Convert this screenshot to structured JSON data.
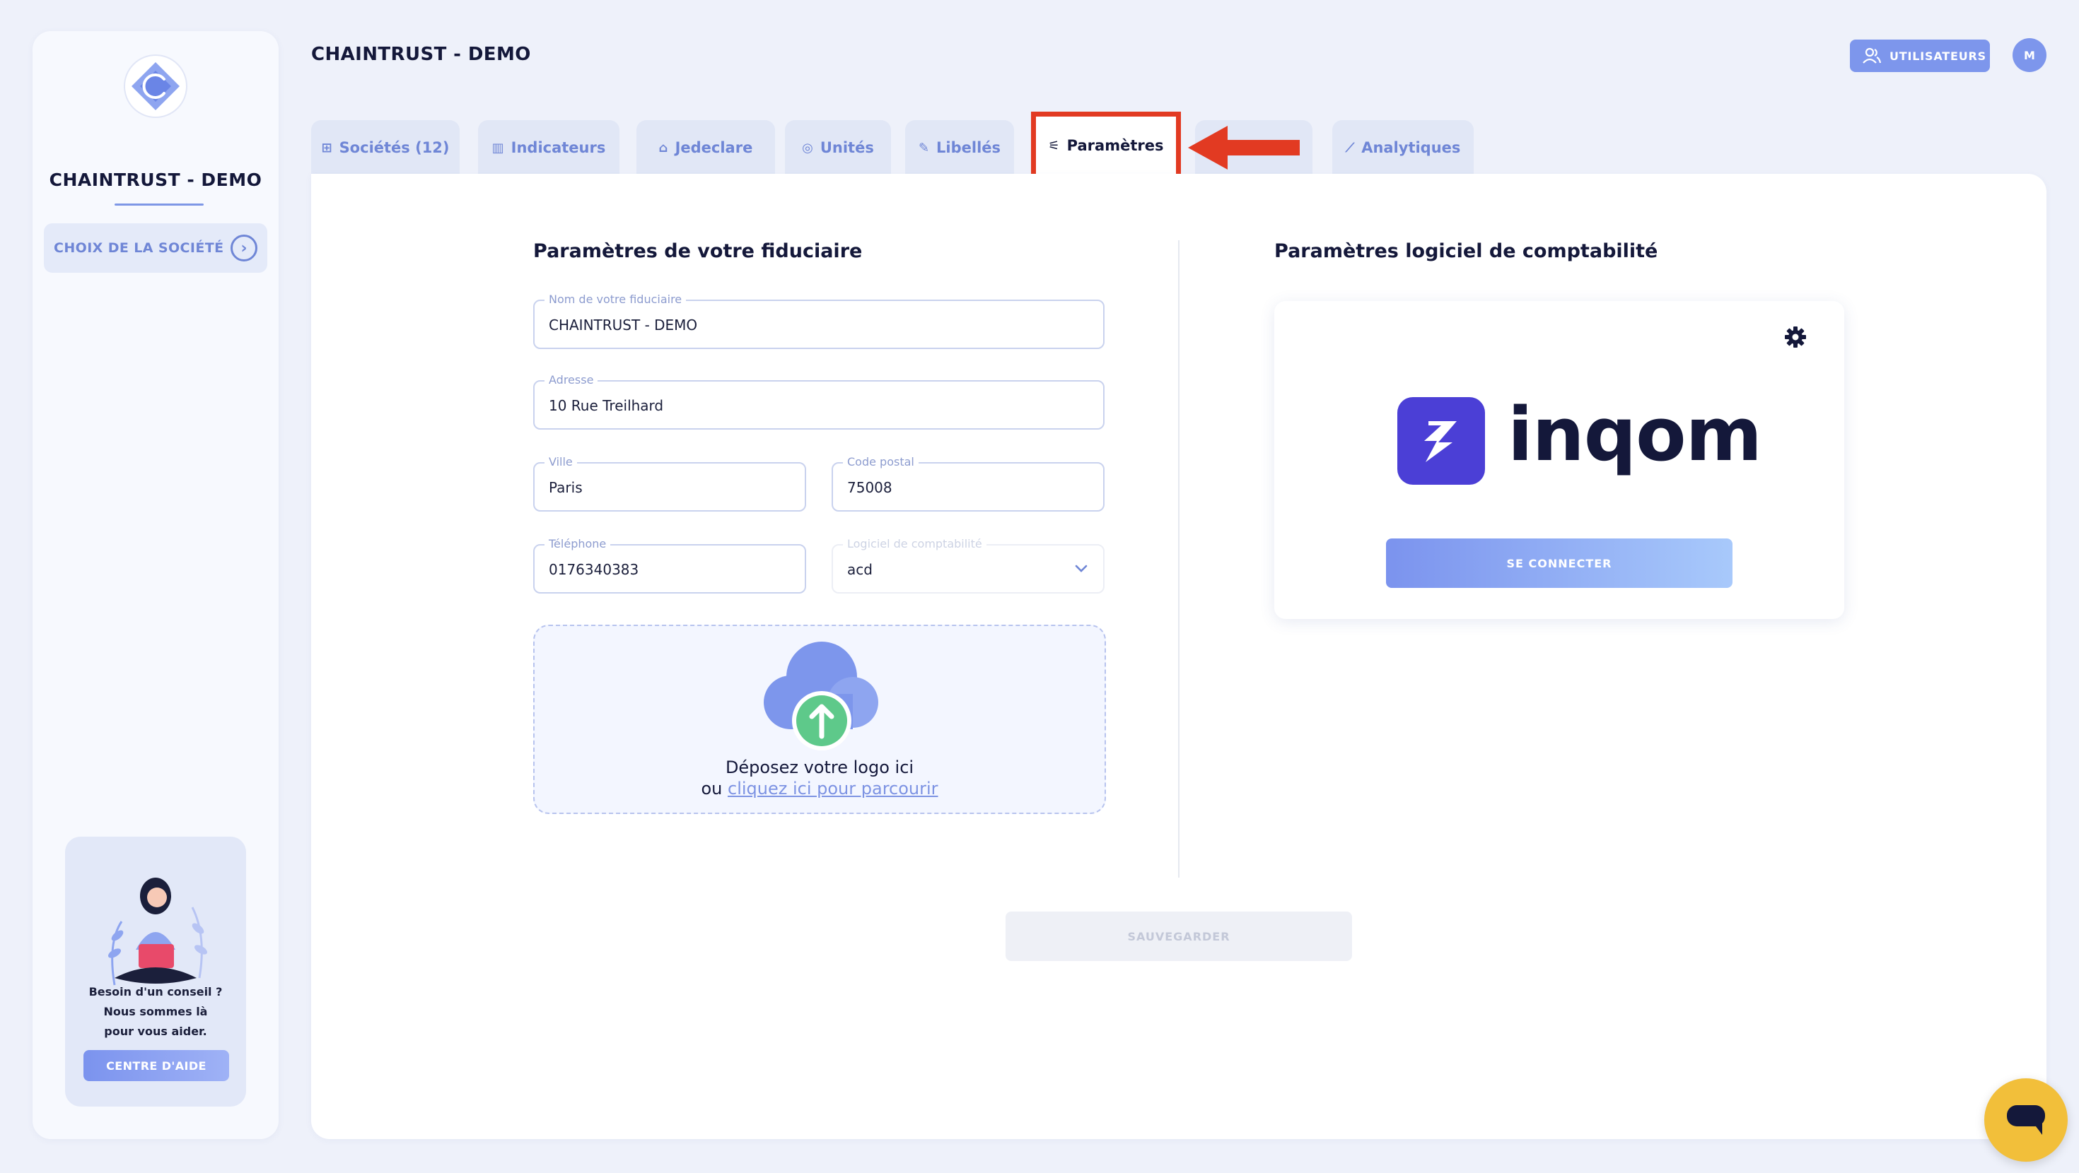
{
  "sidebar": {
    "company_name": "CHAINTRUST - DEMO",
    "choose_company_label": "CHOIX DE LA SOCIÉTÉ",
    "help": {
      "line1": "Besoin d'un conseil ?",
      "line2": "Nous sommes là",
      "line3": "pour vous aider.",
      "button": "CENTRE D'AIDE"
    }
  },
  "header": {
    "title": "CHAINTRUST - DEMO",
    "users_button": "UTILISATEURS",
    "avatar_initial": "M"
  },
  "tabs": [
    {
      "label": "Sociétés (12)",
      "icon": "grid-icon",
      "active": false
    },
    {
      "label": "Indicateurs",
      "icon": "bar-chart-icon",
      "active": false
    },
    {
      "label": "Jedeclare",
      "icon": "bank-icon",
      "active": false
    },
    {
      "label": "Unités",
      "icon": "coin-icon",
      "active": false
    },
    {
      "label": "Libellés",
      "icon": "pen-icon",
      "active": false
    },
    {
      "label": "Paramètres",
      "icon": "sliders-icon",
      "active": true
    },
    {
      "label": "Analytiques",
      "icon": "line-chart-icon",
      "active": false
    }
  ],
  "fiduciaire": {
    "title": "Paramètres de votre fiduciaire",
    "name": {
      "label": "Nom de votre fiduciaire",
      "value": "CHAINTRUST - DEMO"
    },
    "address": {
      "label": "Adresse",
      "value": "10 Rue Treilhard"
    },
    "city": {
      "label": "Ville",
      "value": "Paris"
    },
    "postal_code": {
      "label": "Code postal",
      "value": "75008"
    },
    "phone": {
      "label": "Téléphone",
      "value": "0176340383"
    },
    "software": {
      "label": "Logiciel de comptabilité",
      "value": "acd"
    },
    "dropzone": {
      "text": "Déposez votre logo ici",
      "or": "ou",
      "browse_link": "cliquez ici pour parcourir"
    }
  },
  "software_settings": {
    "title": "Paramètres logiciel de comptabilité",
    "brand": "inqom",
    "connect_button": "SE CONNECTER"
  },
  "save_button": "SAUVEGARDER",
  "colors": {
    "accent": "#7d96ec",
    "highlight_box": "#e23a22",
    "upload_arrow": "#5ec98a",
    "chat": "#f2bf3a",
    "inqom": "#4b3fd6"
  }
}
